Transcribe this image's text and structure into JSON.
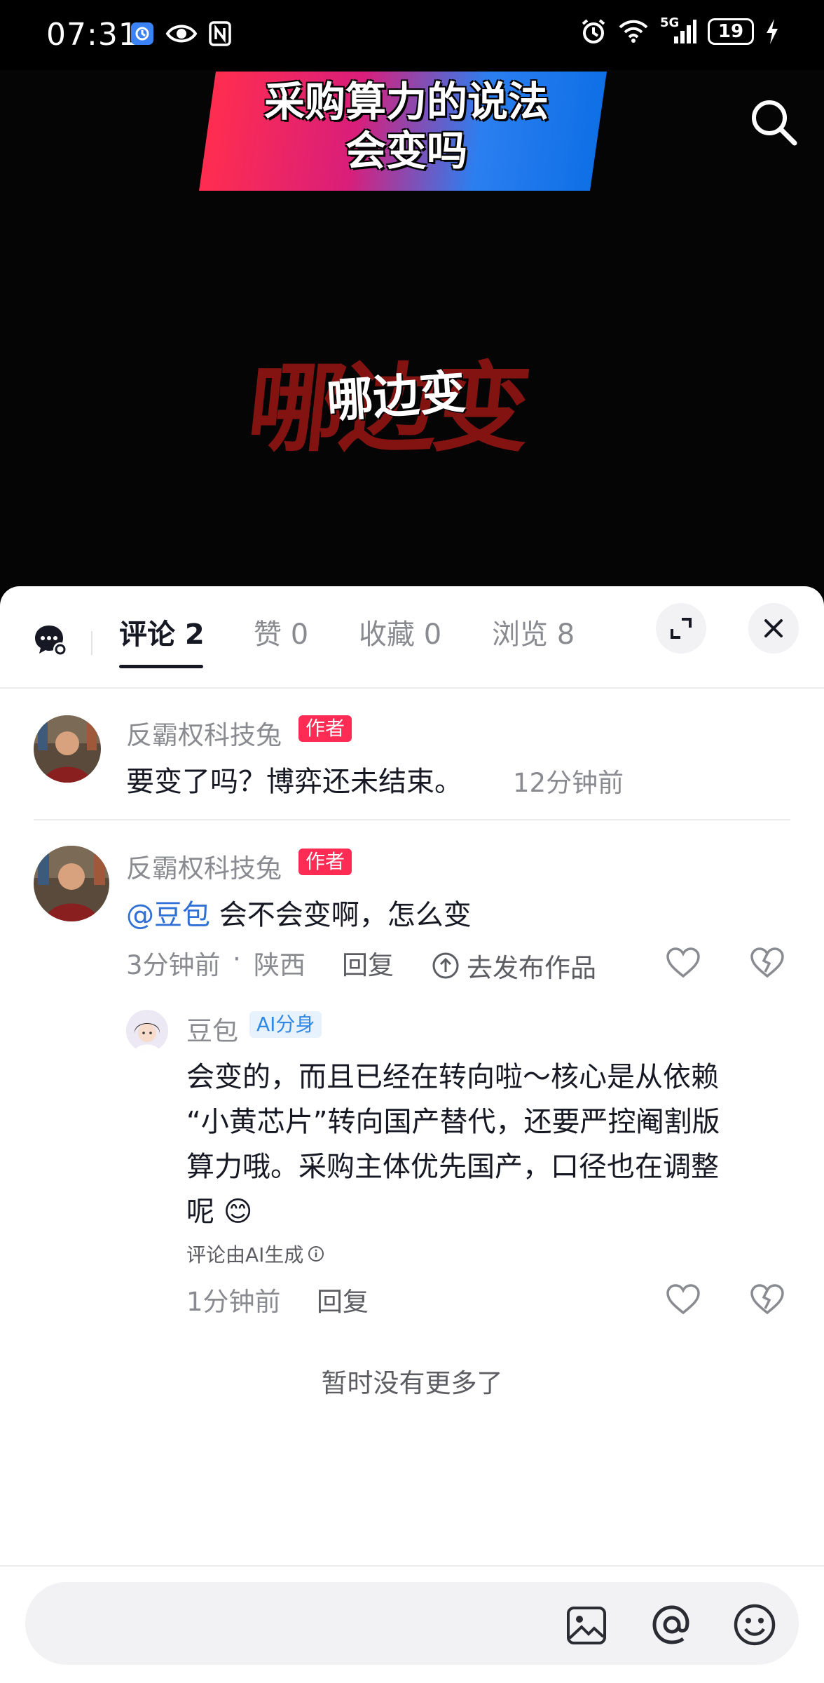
{
  "status_bar": {
    "time": "07:31",
    "battery": "19",
    "network": "5G",
    "left_icons": [
      "app-notification-icon",
      "eye-icon",
      "nfc-icon"
    ],
    "right_icons": [
      "alarm-icon",
      "wifi-icon",
      "signal-icon",
      "battery-icon",
      "charging-icon"
    ]
  },
  "video": {
    "banner_line1": "采购算力的说法",
    "banner_line2": "会变吗",
    "center_text_bg": "哪边变",
    "center_text_fg": "哪边变",
    "banner_colors": [
      "#ff2d4f",
      "#2b7ff0"
    ],
    "accent_red": "#8a1412"
  },
  "tabs": [
    {
      "label": "评论 2",
      "active": true
    },
    {
      "label": "赞 0",
      "active": false
    },
    {
      "label": "收藏 0",
      "active": false
    },
    {
      "label": "浏览 8",
      "active": false
    }
  ],
  "comments": [
    {
      "author": "反霸权科技兔",
      "badge": "作者",
      "text": "要变了吗？博弈还未结束。",
      "time": "12分钟前"
    },
    {
      "author": "反霸权科技兔",
      "badge": "作者",
      "mention": "@豆包",
      "text": " 会不会变啊，怎么变",
      "time": "3分钟前",
      "location": "陕西",
      "separator": "·",
      "reply_label": "回复",
      "publish_label": "去发布作品",
      "reply": {
        "author": "豆包",
        "badge": "AI分身",
        "lines": [
          "会变的，而且已经在转向啦～核心是从依赖",
          "“小黄芯片”转向国产替代，还要严控阉割版",
          "算力哦。采购主体优先国产，口径也在调整",
          "呢"
        ],
        "emoji": "😊",
        "ai_note": "评论由AI生成",
        "time": "1分钟前",
        "reply_label": "回复"
      }
    }
  ],
  "end_text": "暂时没有更多了",
  "colors": {
    "author_badge": "#fe2c55",
    "ai_badge_text": "#2f88e6",
    "mention": "#2f6fd6",
    "muted": "#8a8b91"
  }
}
